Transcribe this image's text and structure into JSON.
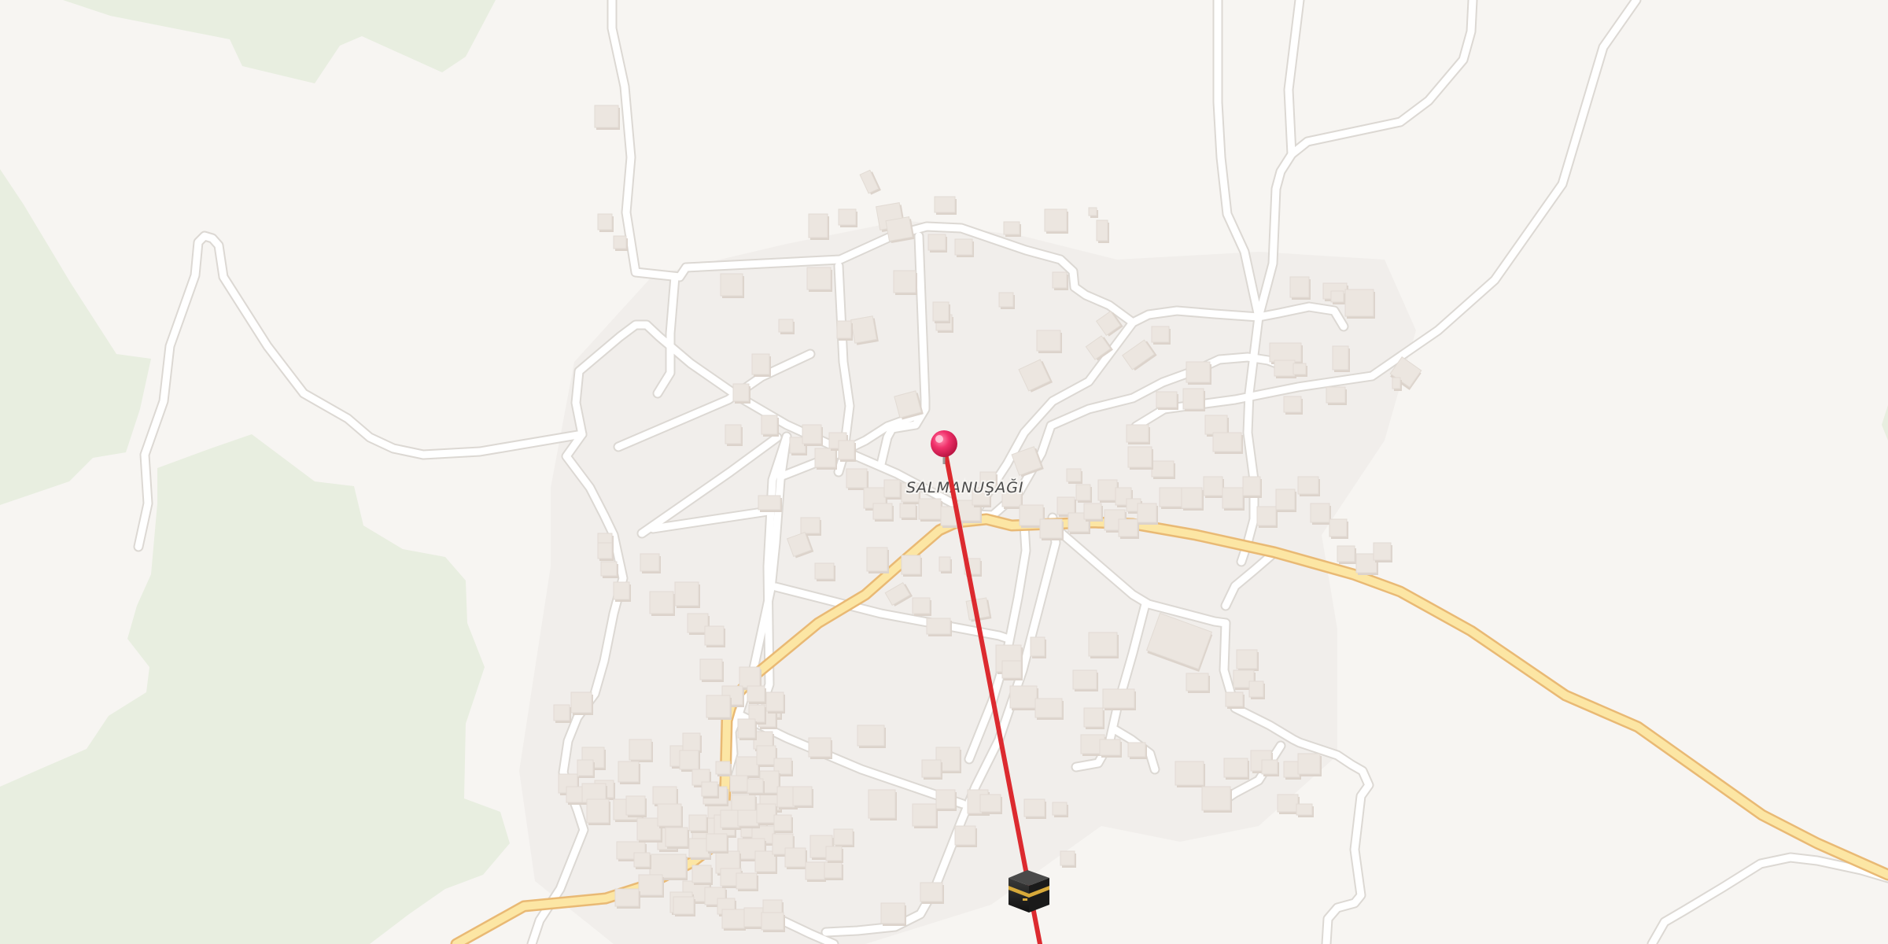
{
  "map": {
    "place_label": "SALMANUŞAĞI",
    "colors": {
      "background": "#f7f5f2",
      "settlement_area": "#f1eeeb",
      "vegetation": "#e8eee0",
      "minor_road": "#ffffff",
      "minor_road_casing": "#dcd8d3",
      "major_road_fill": "#fce6a4",
      "major_road_casing": "#e9b974",
      "building": "#ece6e0",
      "building_side": "#dcd3cb",
      "route_line": "#dc2a2f",
      "pin": "#f0306a"
    },
    "markers": [
      {
        "name": "location-pin",
        "icon": "pin-icon"
      },
      {
        "name": "destination-marker",
        "icon": "kaaba-icon"
      }
    ]
  }
}
